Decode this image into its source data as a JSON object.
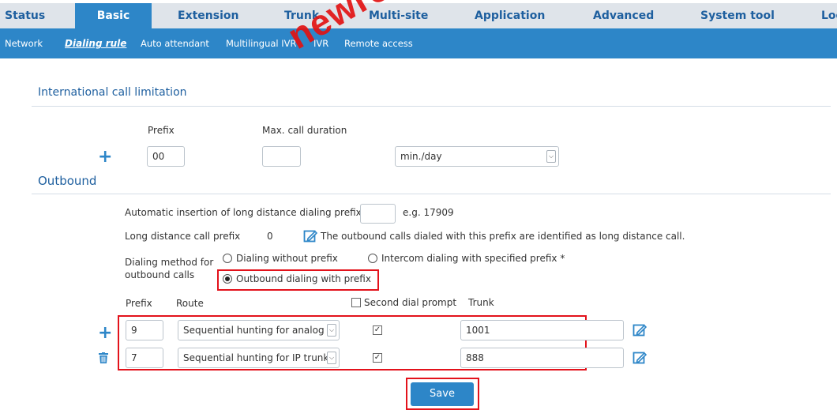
{
  "watermark": "newrock",
  "topnav": {
    "items": [
      "Status",
      "Basic",
      "Extension",
      "Trunk",
      "Multi-site",
      "Application",
      "Advanced",
      "System tool",
      "Log"
    ],
    "active_index": 1
  },
  "subnav": {
    "items": [
      "Network",
      "Dialing rule",
      "Auto attendant",
      "Multilingual IVR",
      "IVR",
      "Remote access"
    ],
    "active_index": 1
  },
  "international": {
    "title": "International call limitation",
    "col_prefix": "Prefix",
    "col_duration": "Max. call duration",
    "prefix_value": "00",
    "duration_value": "",
    "unit_selected": "min./day"
  },
  "outbound": {
    "title": "Outbound",
    "auto_insert_label": "Automatic insertion of long distance dialing prefix",
    "auto_insert_value": "",
    "auto_insert_example": "e.g. 17909",
    "long_distance_label": "Long distance call prefix",
    "long_distance_value": "0",
    "long_distance_note": "The outbound calls dialed with this prefix are identified as long distance call.",
    "method_label_line1": "Dialing method for",
    "method_label_line2": "outbound calls",
    "method_options": [
      "Dialing without prefix",
      "Intercom dialing with specified prefix *",
      "Outbound dialing with prefix"
    ],
    "method_selected": "Outbound dialing with prefix",
    "headers": {
      "prefix": "Prefix",
      "route": "Route",
      "second_dial": "Second dial prompt",
      "trunk": "Trunk"
    },
    "second_dial_checked": false,
    "rows": [
      {
        "prefix": "9",
        "route": "Sequential hunting for analog t",
        "second_dial_checked": true,
        "trunk": "1001"
      },
      {
        "prefix": "7",
        "route": "Sequential hunting for IP trunk",
        "second_dial_checked": true,
        "trunk": "888"
      }
    ]
  },
  "save_label": "Save",
  "colors": {
    "accent": "#2d86c8",
    "nav_text": "#1e5f9f",
    "highlight": "#e3121b"
  }
}
